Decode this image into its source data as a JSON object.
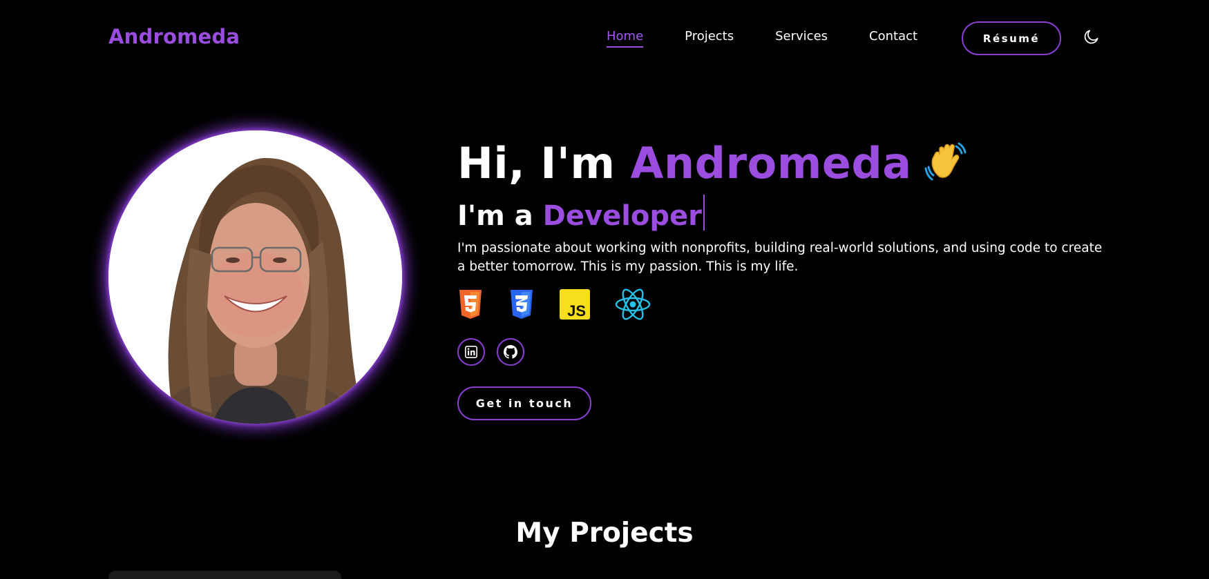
{
  "brand": {
    "name": "Andromeda",
    "accent_color": "#9b4de0"
  },
  "nav": {
    "items": [
      {
        "label": "Home",
        "active": true
      },
      {
        "label": "Projects",
        "active": false
      },
      {
        "label": "Services",
        "active": false
      },
      {
        "label": "Contact",
        "active": false
      }
    ],
    "resume_label": "Résumé",
    "theme_icon": "moon-icon"
  },
  "hero": {
    "greeting": "Hi, I'm ",
    "name": "Andromeda",
    "wave_icon": "waving-hand-icon",
    "role_prefix": "I'm a ",
    "role": "Developer",
    "description": "I'm passionate about working with nonprofits, building real-world solutions, and using code to create a better tomorrow. This is my passion. This is my life.",
    "tech_icons": [
      "html5-icon",
      "css3-icon",
      "javascript-icon",
      "react-icon"
    ],
    "tech_labels": {
      "js": "JS"
    },
    "socials": [
      "linkedin-icon",
      "github-icon"
    ],
    "cta_label": "Get in touch"
  },
  "projects": {
    "title": "My Projects"
  }
}
